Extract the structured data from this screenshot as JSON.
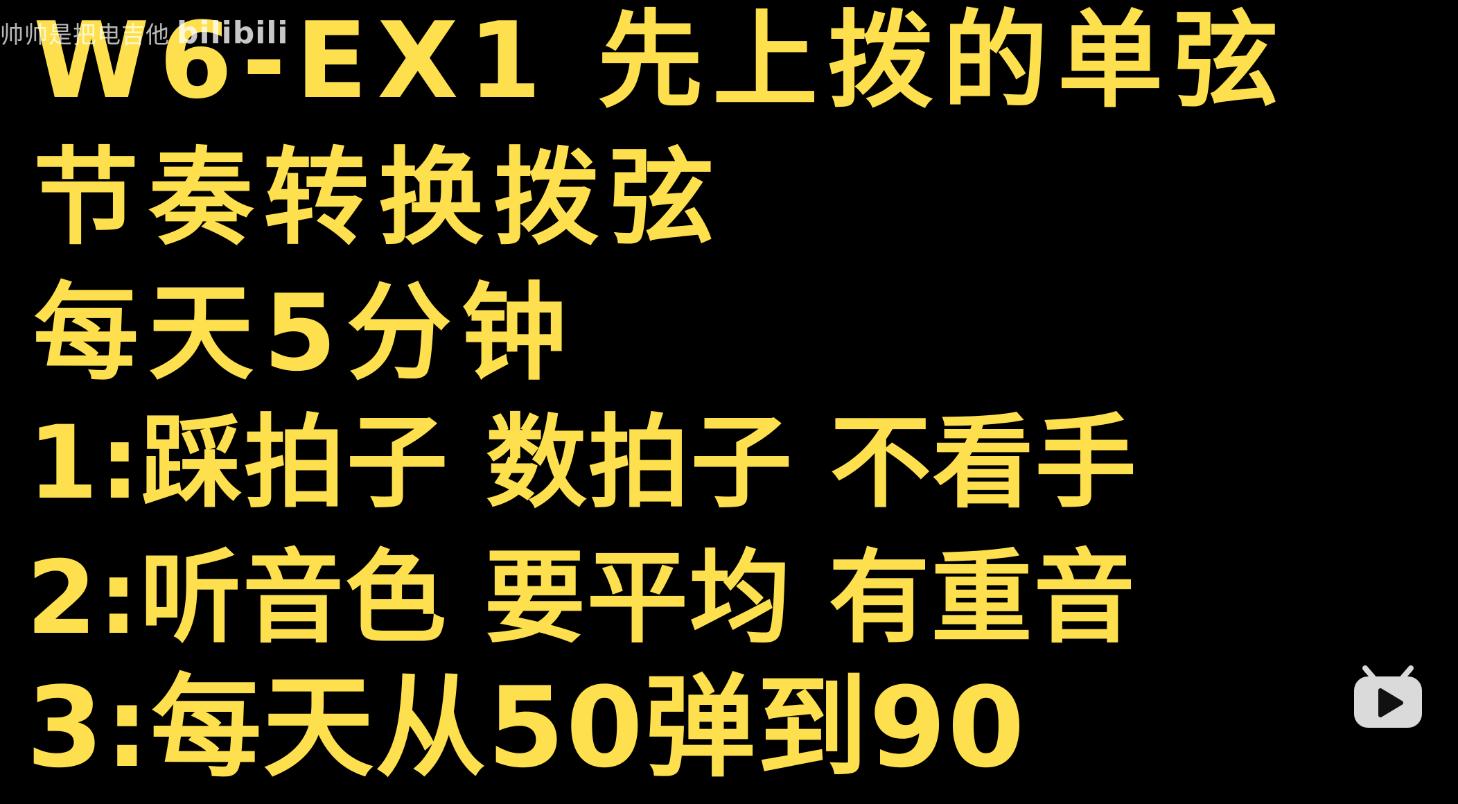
{
  "watermark": {
    "uploader": "帅帅是把电吉他",
    "brand": "bilibili"
  },
  "lines": [
    "W6-EX1 先上拨的单弦",
    "节奏转换拨弦",
    "每天5分钟",
    "1:踩拍子 数拍子 不看手",
    "2:听音色 要平均 有重音",
    "3:每天从50弹到90"
  ],
  "icons": {
    "play_badge": "bilibili-tv-play-icon"
  },
  "colors": {
    "background": "#000000",
    "text": "#FEE04F",
    "watermark": "#FFFFFF"
  }
}
